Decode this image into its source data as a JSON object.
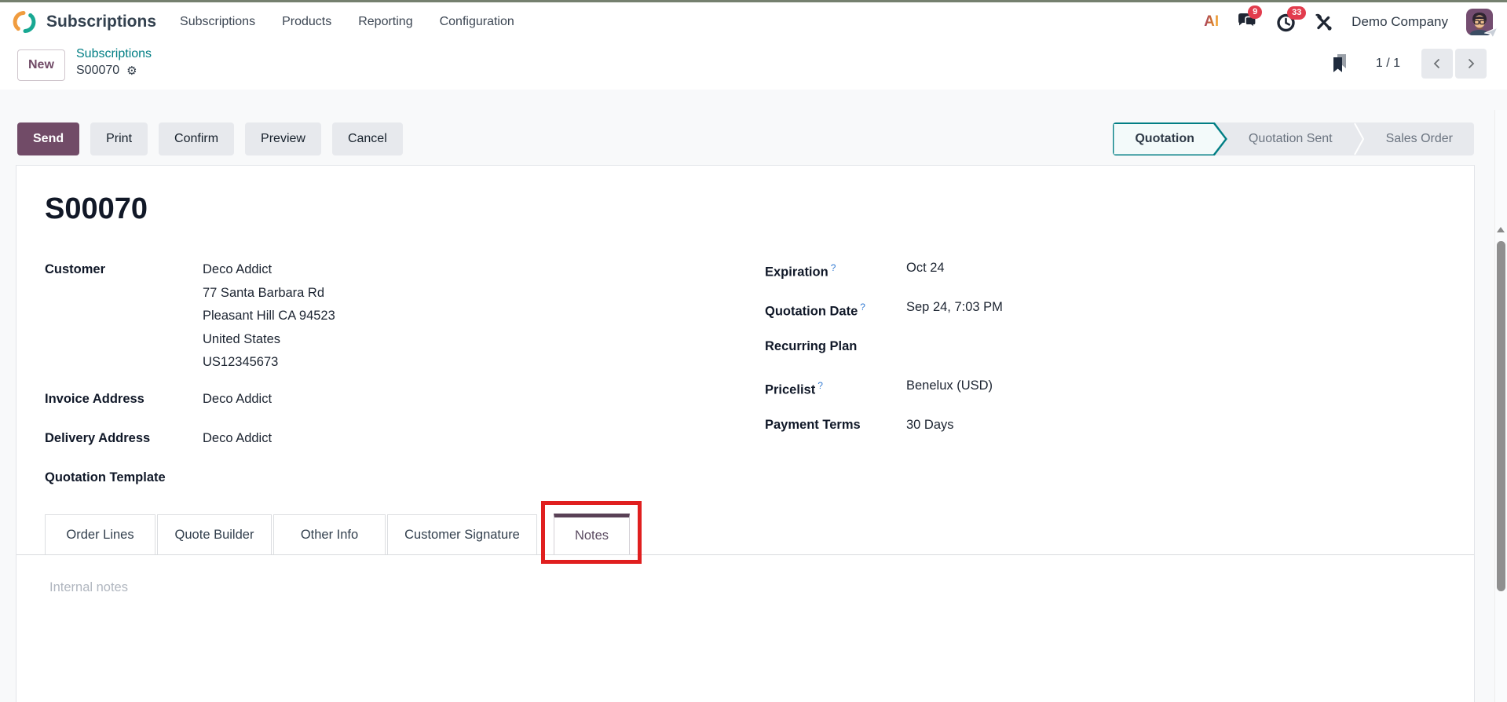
{
  "topbar": {
    "brand": "Subscriptions",
    "menus": [
      "Subscriptions",
      "Products",
      "Reporting",
      "Configuration"
    ],
    "ai_label": "AI",
    "messages_badge": "9",
    "activities_badge": "33",
    "company": "Demo Company"
  },
  "breadcrumb": {
    "new_button": "New",
    "parent": "Subscriptions",
    "current": "S00070",
    "pager_counter": "1 / 1"
  },
  "actions": {
    "send": "Send",
    "print": "Print",
    "confirm": "Confirm",
    "preview": "Preview",
    "cancel": "Cancel"
  },
  "statusbar": {
    "steps": [
      "Quotation",
      "Quotation Sent",
      "Sales Order"
    ],
    "active": "Quotation"
  },
  "form": {
    "title": "S00070",
    "left_fields": [
      {
        "label": "Customer",
        "values": [
          "Deco Addict",
          "77 Santa Barbara Rd",
          "Pleasant Hill CA 94523",
          "United States",
          "US12345673"
        ]
      },
      {
        "label": "Invoice Address",
        "values": [
          "Deco Addict"
        ]
      },
      {
        "label": "Delivery Address",
        "values": [
          "Deco Addict"
        ]
      },
      {
        "label": "Quotation Template",
        "values": []
      }
    ],
    "right_fields": [
      {
        "label": "Expiration",
        "help": "?",
        "value": "Oct 24"
      },
      {
        "label": "Quotation Date",
        "help": "?",
        "value": "Sep 24, 7:03 PM"
      },
      {
        "label": "Recurring Plan",
        "help": "",
        "value": ""
      },
      {
        "label": "Pricelist",
        "help": "?",
        "value": "Benelux (USD)"
      },
      {
        "label": "Payment Terms",
        "help": "",
        "value": "30 Days"
      }
    ],
    "tabs": [
      "Order Lines",
      "Quote Builder",
      "Other Info",
      "Customer Signature",
      "Notes"
    ],
    "active_tab": "Notes",
    "notes_placeholder": "Internal notes"
  },
  "icons": {
    "gear": "⚙"
  },
  "colors": {
    "accent_purple": "#714B67",
    "link_teal": "#017e84",
    "badge_red": "#e23c4d",
    "annotation_red": "#e01f1f",
    "status_active_border": "#017e84"
  }
}
